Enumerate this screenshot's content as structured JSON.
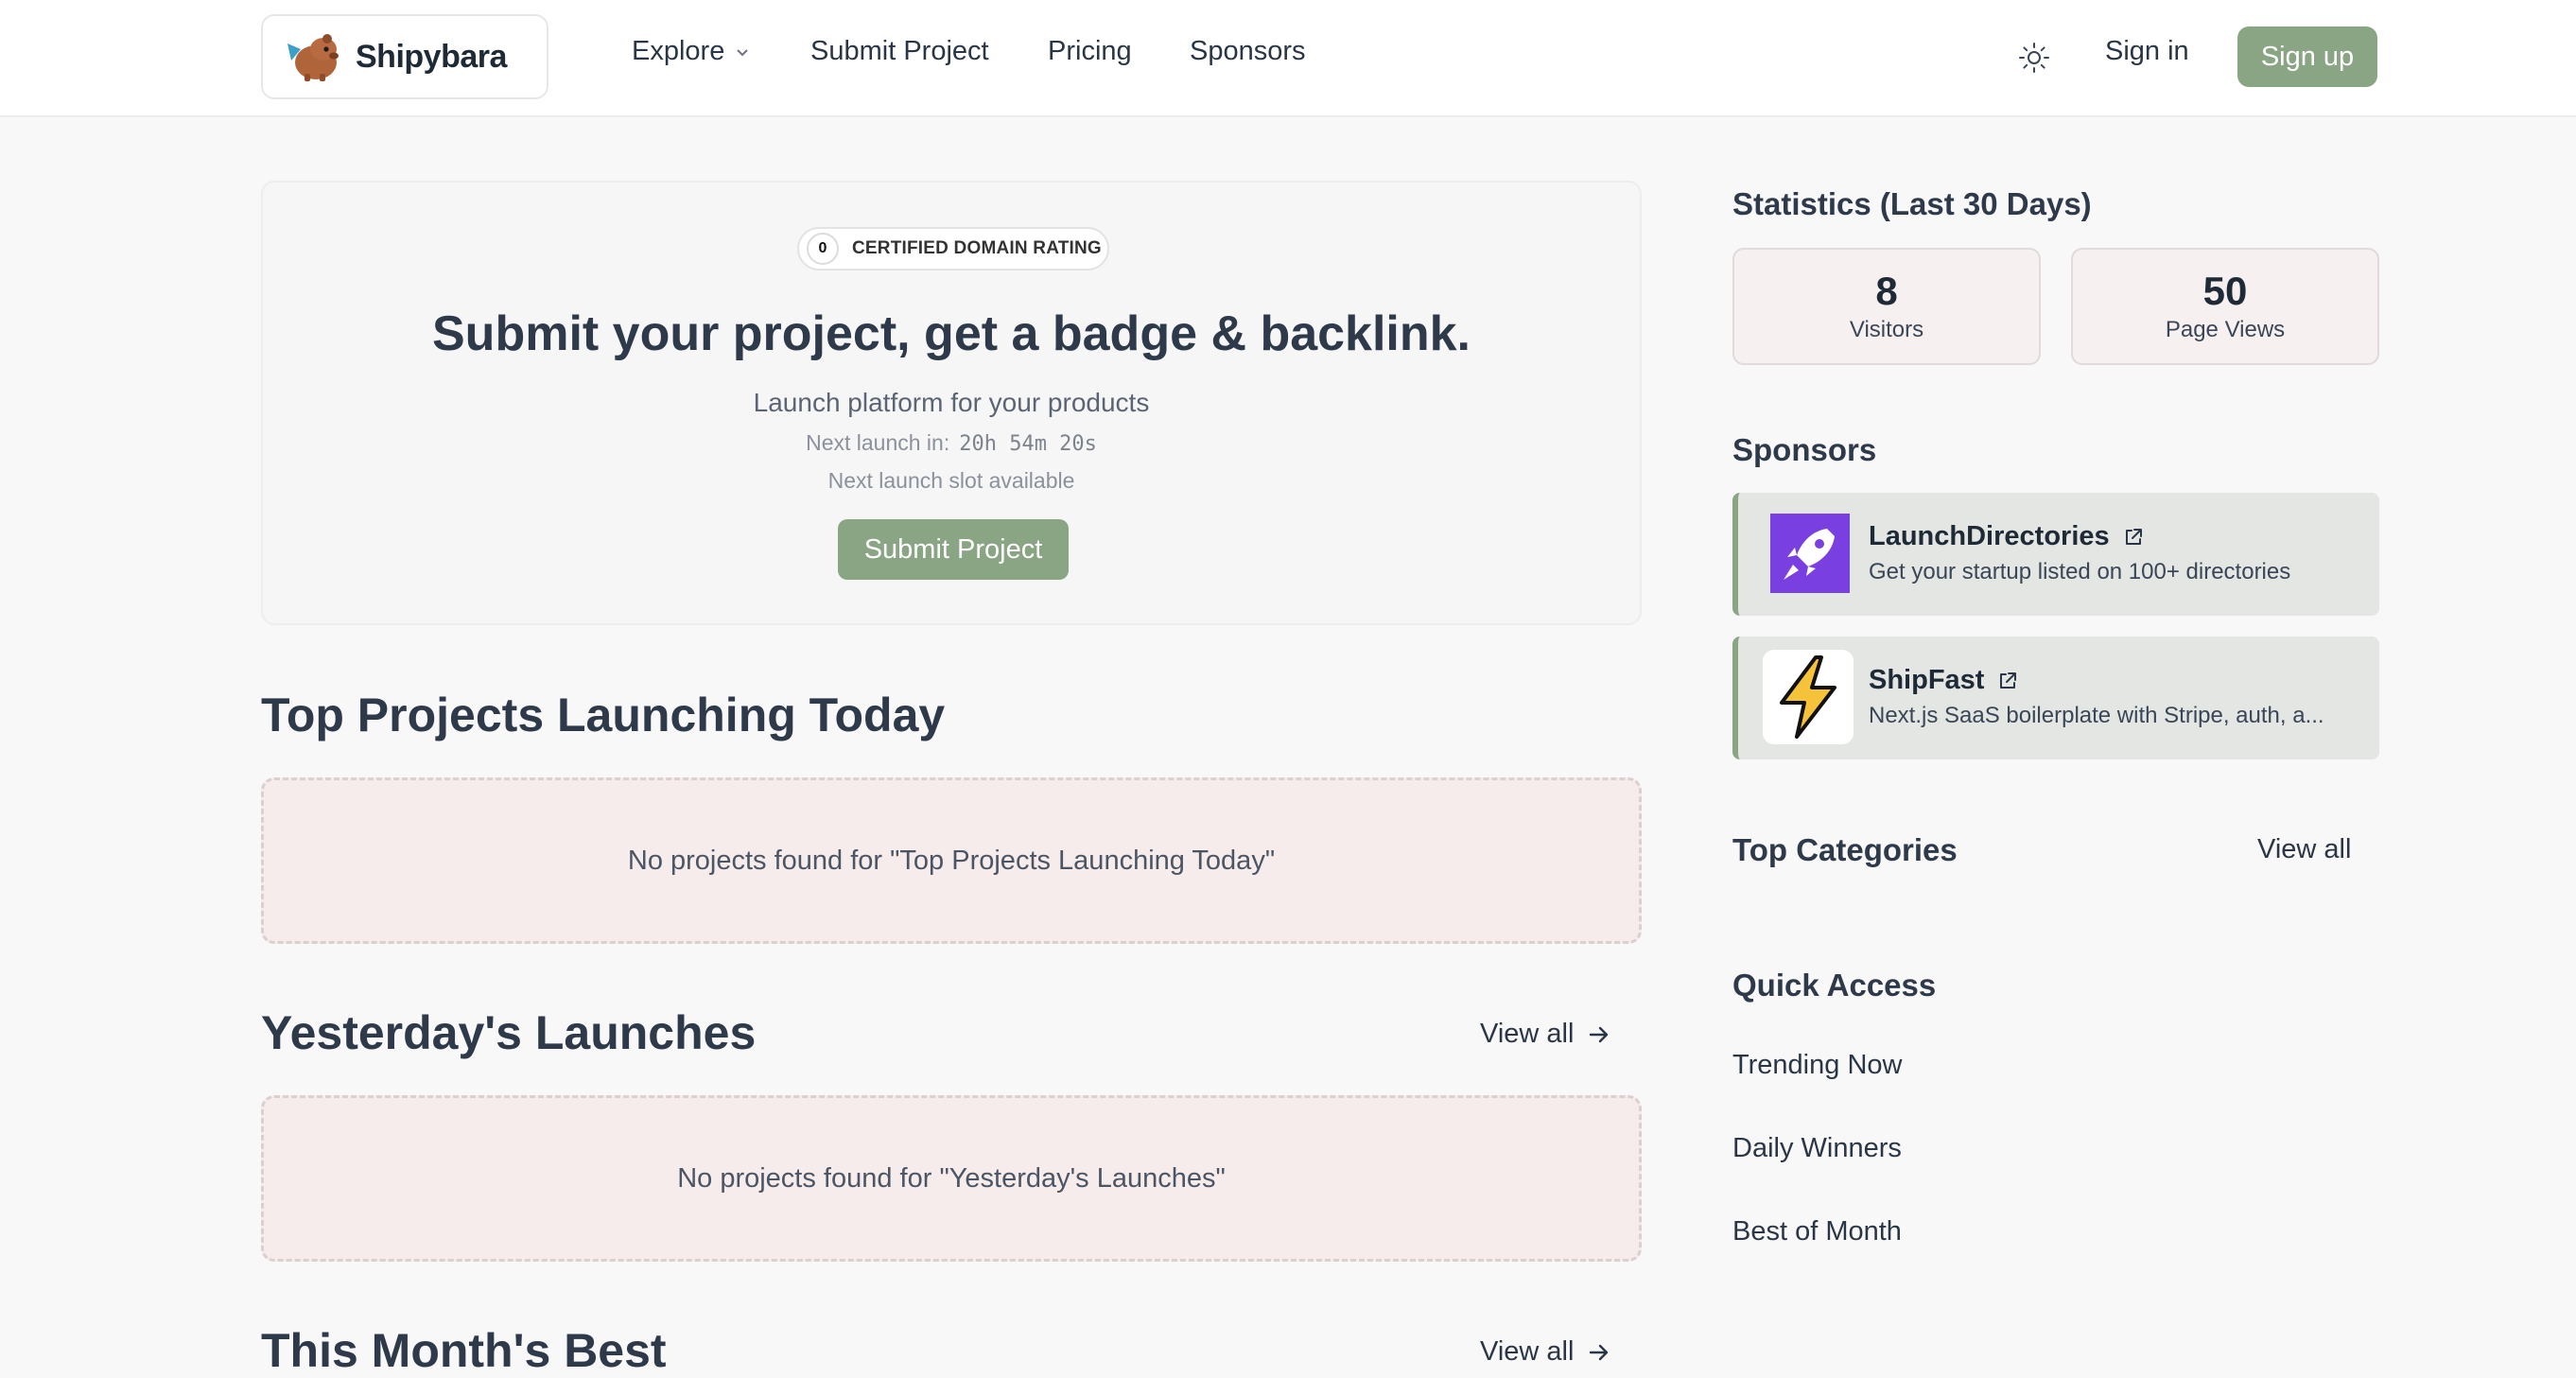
{
  "header": {
    "logo": "Shipybara",
    "nav": {
      "explore": "Explore",
      "submit": "Submit Project",
      "pricing": "Pricing",
      "sponsors": "Sponsors"
    },
    "sign_in": "Sign in",
    "sign_up": "Sign up"
  },
  "hero": {
    "rating_value": "0",
    "rating_label": "CERTIFIED DOMAIN RATING",
    "title": "Submit your project, get a badge & backlink.",
    "subtitle": "Launch platform for your products",
    "next_launch_label": "Next launch in:",
    "next_launch_time": "20h 54m 20s",
    "slot": "Next launch slot available",
    "button": "Submit Project"
  },
  "sections": {
    "today": {
      "title": "Top Projects Launching Today",
      "empty": "No projects found for \"Top Projects Launching Today\""
    },
    "yesterday": {
      "title": "Yesterday's Launches",
      "view_all": "View all",
      "empty": "No projects found for \"Yesterday's Launches\""
    },
    "month": {
      "title": "This Month's Best",
      "view_all": "View all"
    }
  },
  "sidebar": {
    "stats_title": "Statistics (Last 30 Days)",
    "stats": [
      {
        "value": "8",
        "label": "Visitors"
      },
      {
        "value": "50",
        "label": "Page Views"
      }
    ],
    "sponsors_title": "Sponsors",
    "sponsors": [
      {
        "name": "LaunchDirectories",
        "desc": "Get your startup listed on 100+ directories"
      },
      {
        "name": "ShipFast",
        "desc": "Next.js SaaS boilerplate with Stripe, auth, a..."
      }
    ],
    "categories_title": "Top Categories",
    "categories_view_all": "View all",
    "quick_title": "Quick Access",
    "quick_links": [
      "Trending Now",
      "Daily Winners",
      "Best of Month"
    ]
  },
  "colors": {
    "accent": "#8aa584",
    "empty_bg": "#f7ecec",
    "page_bg": "#f8f8f9"
  }
}
